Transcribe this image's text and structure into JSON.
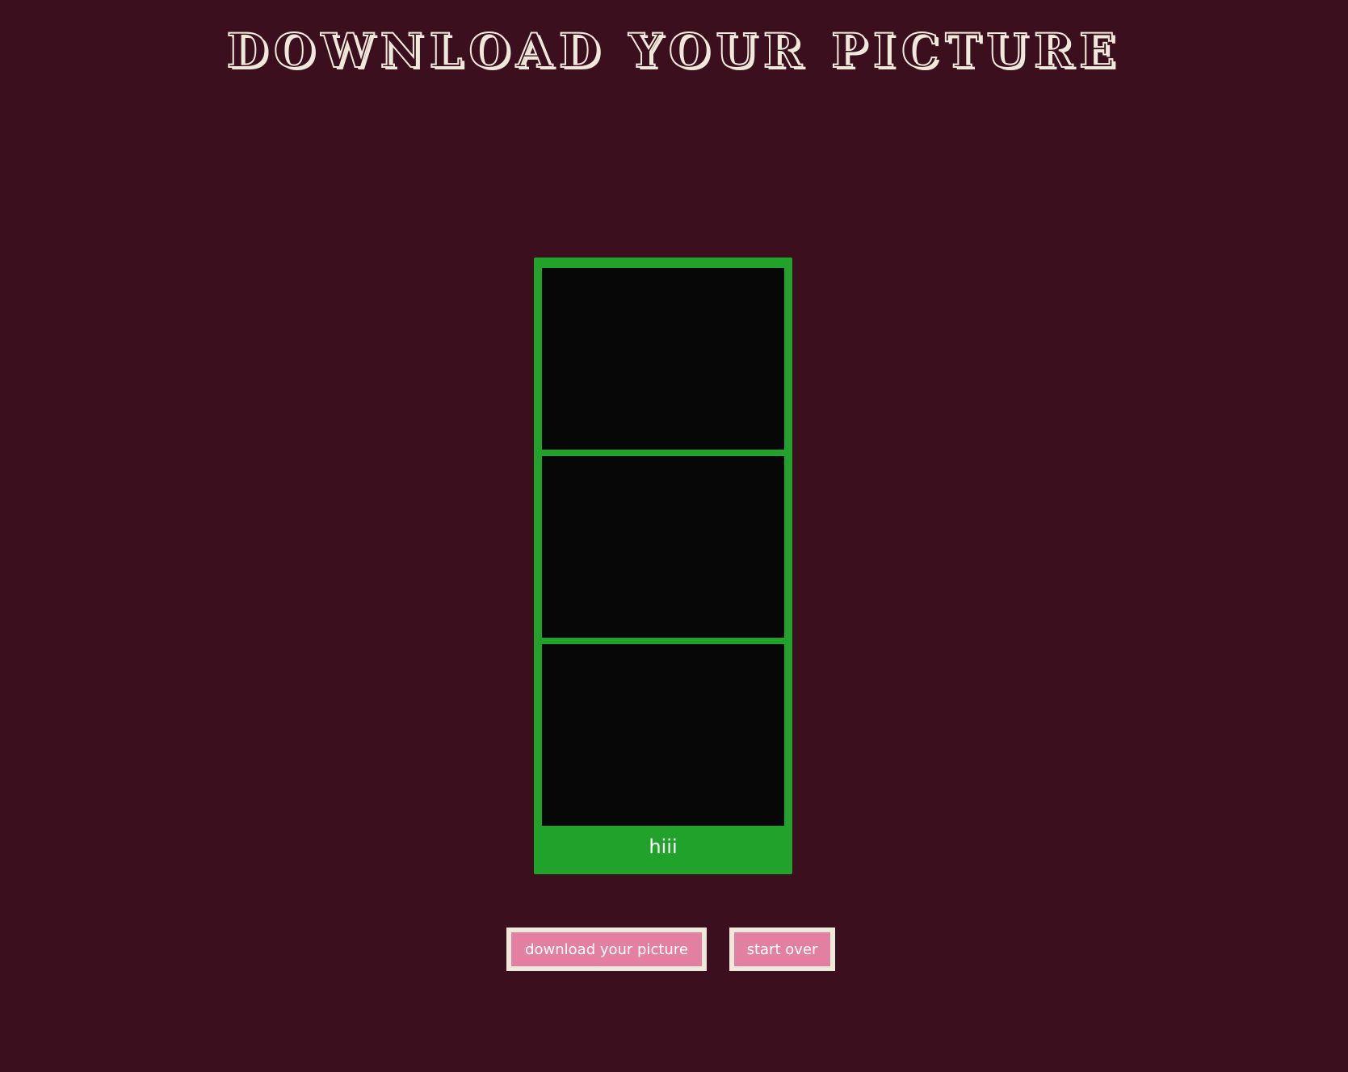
{
  "header": {
    "title": "DOWNLOAD YOUR PICTURE"
  },
  "photo_strip": {
    "frame_color": "#21a22b",
    "photos": [
      "",
      "",
      ""
    ],
    "caption": "hiii"
  },
  "actions": {
    "download_label": "download your picture",
    "start_over_label": "start over"
  },
  "colors": {
    "background": "#3b0f1e",
    "button": "#e37fa1",
    "button_border": "#efe9dc"
  }
}
